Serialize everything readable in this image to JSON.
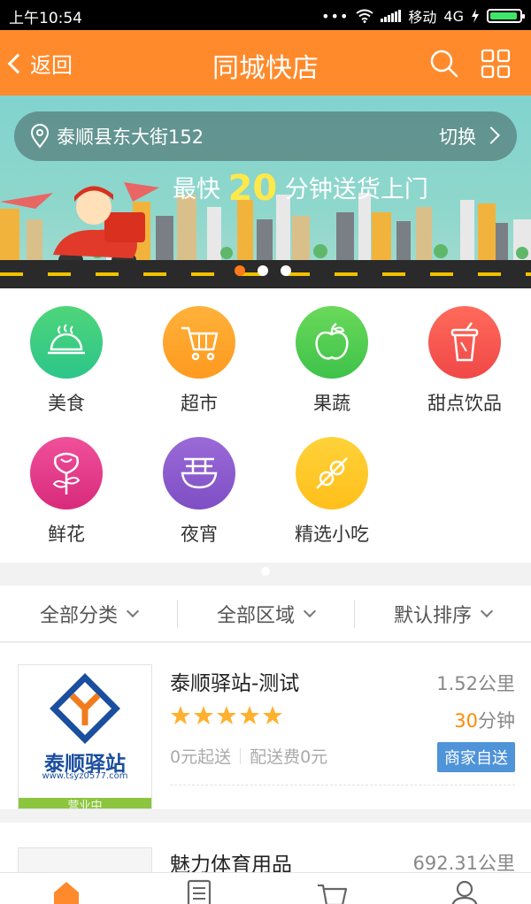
{
  "status": {
    "time": "上午10:54",
    "carrier": "移动",
    "network": "4G"
  },
  "header": {
    "back_label": "返回",
    "title": "同城快店"
  },
  "banner": {
    "address": "泰顺县东大街152",
    "switch_label": "切换",
    "slogan_pre": "最快",
    "slogan_num": "20",
    "slogan_post": "分钟送货上门",
    "active_dot": 0,
    "dot_count": 3
  },
  "categories": [
    {
      "label": "美食",
      "icon": "food-cloche-icon",
      "color_top": "#4fd57a",
      "color_bottom": "#2cc58a"
    },
    {
      "label": "超市",
      "icon": "shopping-cart-icon",
      "color_top": "#ffb13a",
      "color_bottom": "#ff9a1f"
    },
    {
      "label": "果蔬",
      "icon": "apple-icon",
      "color_top": "#6ad95a",
      "color_bottom": "#3ec24a"
    },
    {
      "label": "甜点饮品",
      "icon": "drink-cup-icon",
      "color_top": "#ff6a5a",
      "color_bottom": "#f04848"
    },
    {
      "label": "鲜花",
      "icon": "rose-icon",
      "color_top": "#f0509a",
      "color_bottom": "#d82a7c"
    },
    {
      "label": "夜宵",
      "icon": "noodle-bowl-icon",
      "color_top": "#9b6ad8",
      "color_bottom": "#7e4fc4"
    },
    {
      "label": "精选小吃",
      "icon": "skewer-icon",
      "color_top": "#ffd23a",
      "color_bottom": "#ffbf1a"
    }
  ],
  "filters": {
    "category": "全部分类",
    "area": "全部区域",
    "sort": "默认排序"
  },
  "stores": [
    {
      "name": "泰顺驿站-测试",
      "distance": "1.52公里",
      "eta_num": "30",
      "eta_unit": "分钟",
      "min_order": "0元起送",
      "delivery_fee": "配送费0元",
      "tag": "商家自送",
      "logo_text": "泰顺驿站",
      "logo_url": "www.tsyz0577.com",
      "open_label": "营业中",
      "rating": 5
    },
    {
      "name": "魅力体育用品",
      "distance": "692.31公里"
    }
  ],
  "colors": {
    "brand": "#ff8a2b",
    "accent": "#ff8a00",
    "tag": "#4f93d9"
  }
}
